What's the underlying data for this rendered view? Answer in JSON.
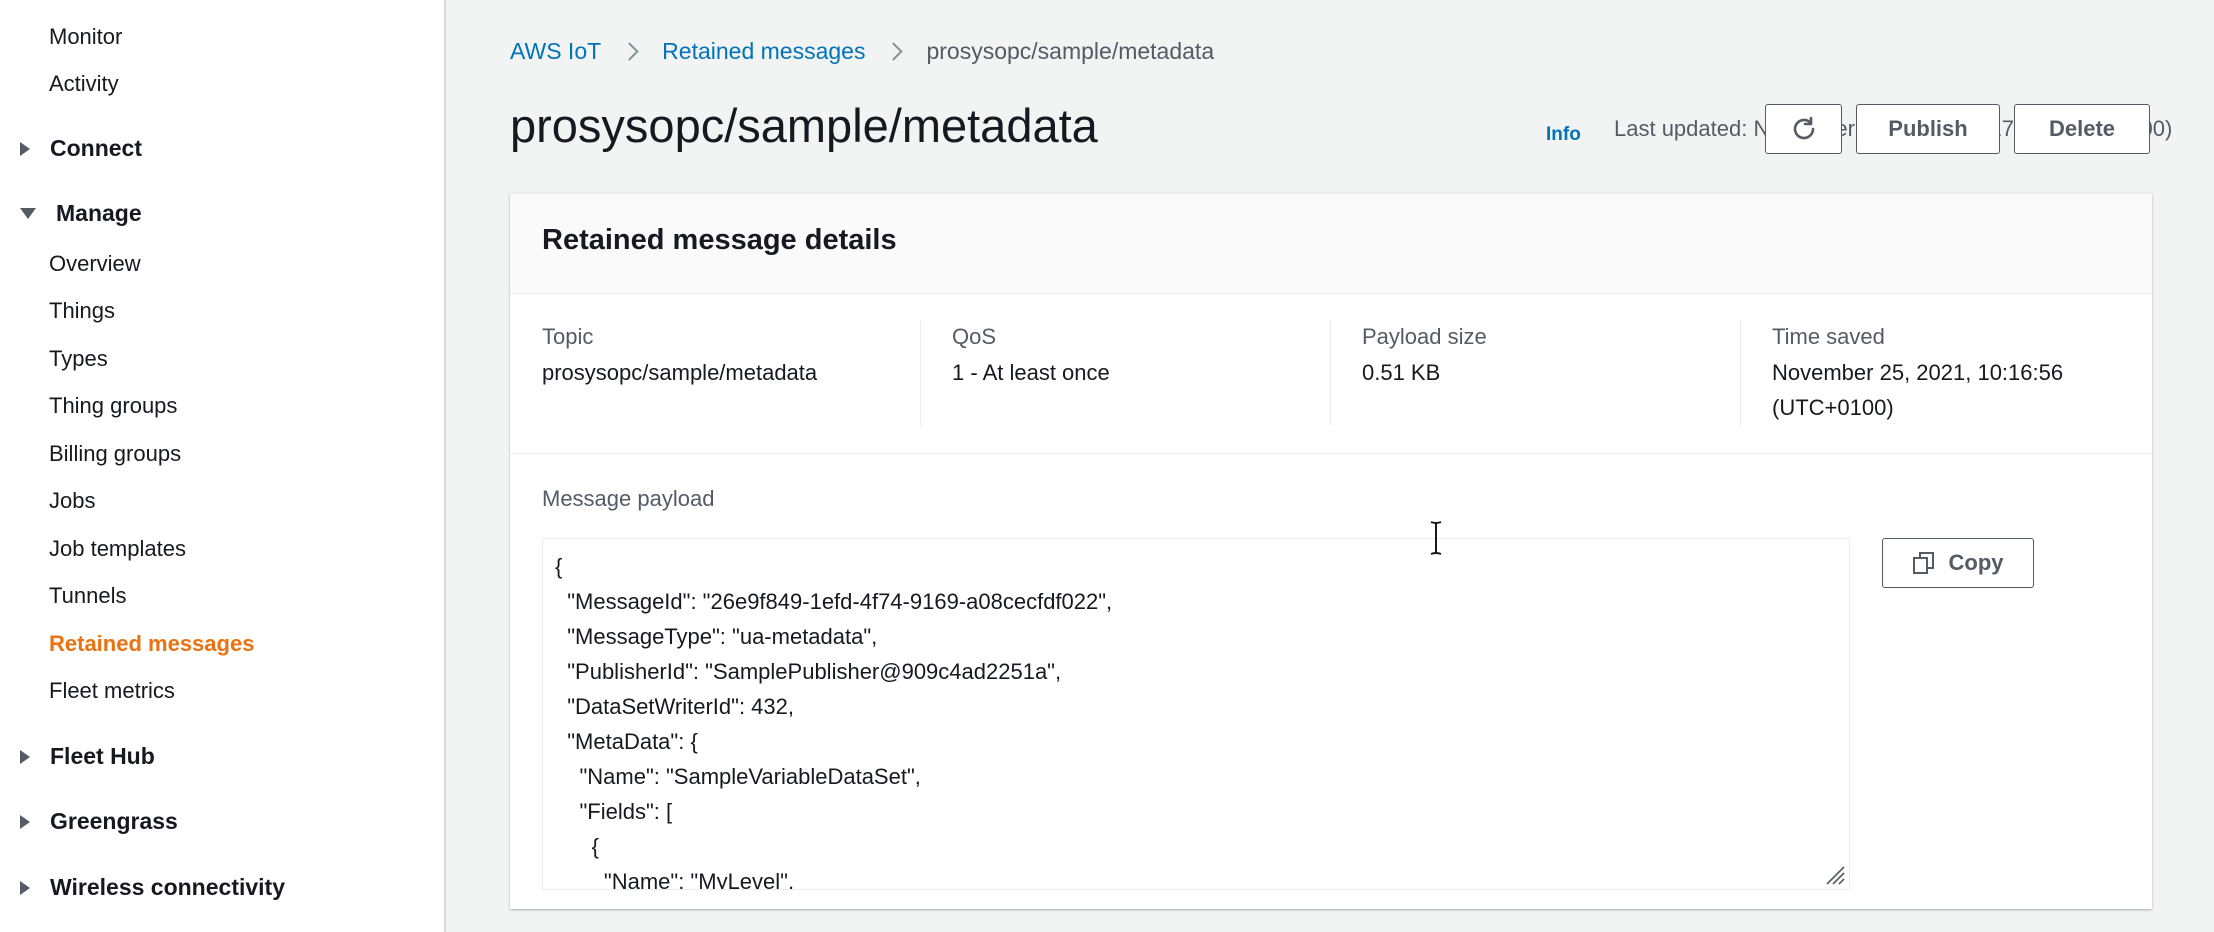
{
  "sidebar": {
    "top_items": [
      {
        "label": "Monitor"
      },
      {
        "label": "Activity"
      }
    ],
    "sections": {
      "connect": "Connect",
      "manage": "Manage",
      "fleet_hub": "Fleet Hub",
      "greengrass": "Greengrass",
      "wireless": "Wireless connectivity"
    },
    "manage_items": [
      {
        "label": "Overview"
      },
      {
        "label": "Things"
      },
      {
        "label": "Types"
      },
      {
        "label": "Thing groups"
      },
      {
        "label": "Billing groups"
      },
      {
        "label": "Jobs"
      },
      {
        "label": "Job templates"
      },
      {
        "label": "Tunnels"
      },
      {
        "label": "Retained messages"
      },
      {
        "label": "Fleet metrics"
      }
    ],
    "active_color": "#ec7211"
  },
  "breadcrumb": {
    "items": [
      "AWS IoT",
      "Retained messages",
      "prosysopc/sample/metadata"
    ]
  },
  "header": {
    "title": "prosysopc/sample/metadata",
    "info": "Info",
    "last_updated": "Last updated: November 25, 2021, 10:17:02 (UTC+0100)",
    "refresh_icon": "refresh-icon",
    "publish_label": "Publish",
    "delete_label": "Delete"
  },
  "details": {
    "title": "Retained message details",
    "topic_label": "Topic",
    "topic_value": "prosysopc/sample/metadata",
    "qos_label": "QoS",
    "qos_value": "1 - At least once",
    "payload_size_label": "Payload size",
    "payload_size_value": "0.51 KB",
    "time_saved_label": "Time saved",
    "time_saved_line1": "November 25, 2021, 10:16:56",
    "time_saved_line2": "(UTC+0100)"
  },
  "payload": {
    "label": "Message payload",
    "copy_label": "Copy",
    "lines": [
      "{",
      "  \"MessageId\": \"26e9f849-1efd-4f74-9169-a08cecfdf022\",",
      "  \"MessageType\": \"ua-metadata\",",
      "  \"PublisherId\": \"SamplePublisher@909c4ad2251a\",",
      "  \"DataSetWriterId\": 432,",
      "  \"MetaData\": {",
      "    \"Name\": \"SampleVariableDataSet\",",
      "    \"Fields\": [",
      "      {",
      "        \"Name\": \"MyLevel\","
    ]
  },
  "colors": {
    "link": "#0073bb",
    "accent": "#ec7211",
    "text": "#16191f",
    "muted": "#545b64"
  }
}
